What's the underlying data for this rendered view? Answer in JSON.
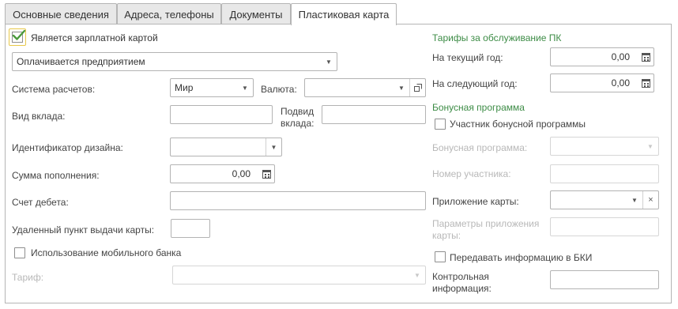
{
  "tabs": [
    {
      "label": "Основные сведения"
    },
    {
      "label": "Адреса, телефоны"
    },
    {
      "label": "Документы"
    },
    {
      "label": "Пластиковая карта"
    }
  ],
  "left": {
    "salary_card": {
      "label": "Является зарплатной картой",
      "checked": true
    },
    "payment_type": {
      "value": "Оплачивается предприятием"
    },
    "payment_system": {
      "label": "Система расчетов:",
      "value": "Мир"
    },
    "currency": {
      "label": "Валюта:",
      "value": ""
    },
    "deposit_type": {
      "label": "Вид вклада:",
      "value": ""
    },
    "deposit_subtype": {
      "label": "Подвид вклада:",
      "value": ""
    },
    "design_id": {
      "label": "Идентификатор дизайна:",
      "value": ""
    },
    "topup_amount": {
      "label": "Сумма пополнения:",
      "value": "0,00"
    },
    "debit_account": {
      "label": "Счет дебета:",
      "value": ""
    },
    "pickup_point": {
      "label": "Удаленный пункт выдачи карты:",
      "value": ""
    },
    "mobile_bank": {
      "label": "Использование мобильного банка",
      "checked": false
    },
    "tariff": {
      "label": "Тариф:",
      "value": ""
    }
  },
  "right": {
    "tariffs_title": "Тарифы за обслуживание ПК",
    "current_year": {
      "label": "На текущий год:",
      "value": "0,00"
    },
    "next_year": {
      "label": "На следующий год:",
      "value": "0,00"
    },
    "bonus_title": "Бонусная программа",
    "bonus_participant": {
      "label": "Участник бонусной программы",
      "checked": false
    },
    "bonus_program": {
      "label": "Бонусная программа:",
      "value": ""
    },
    "member_number": {
      "label": "Номер участника:",
      "value": ""
    },
    "card_app": {
      "label": "Приложение карты:",
      "value": ""
    },
    "app_params": {
      "label": "Параметры приложения карты:",
      "value": ""
    },
    "bki": {
      "label": "Передавать информацию в БКИ",
      "checked": false
    },
    "control_info": {
      "label": "Контрольная информация:",
      "value": ""
    }
  },
  "icons": {
    "dropdown": "chevron-down-icon",
    "calculator": "calculator-icon",
    "open": "open-window-icon",
    "clear": "clear-icon",
    "check": "checkmark-icon"
  },
  "colors": {
    "section_title": "#3d8c46",
    "checkmark": "#4a9a3c",
    "focus_border": "#e8c84a",
    "disabled_text": "#b8b8b8"
  }
}
